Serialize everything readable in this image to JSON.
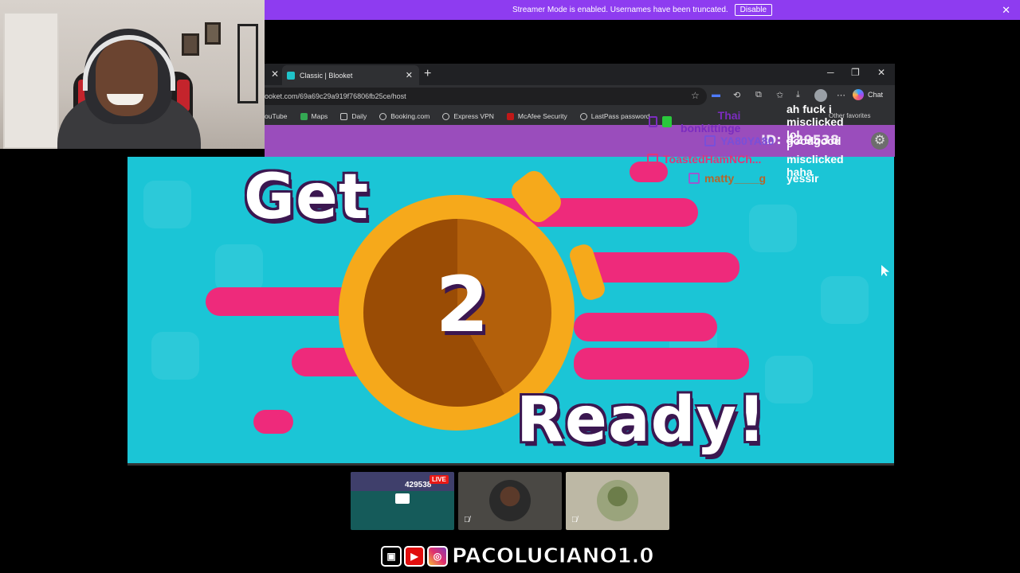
{
  "banner": {
    "text": "Streamer Mode is enabled. Usernames have been truncated.",
    "button": "Disable",
    "close": "✕"
  },
  "browser": {
    "tab_title": "Classic | Blooket",
    "url": "ooket.com/69a69c29a919f76806fb25ce/host",
    "chat_label": "Chat",
    "bookmarks": [
      "ouTube",
      "Maps",
      "Daily",
      "Booking.com",
      "Express VPN",
      "McAfee Security",
      "LastPass password"
    ],
    "other_favorites": "Other favorites",
    "minimize": "─",
    "restore": "❐",
    "close": "✕",
    "new_tab": "+",
    "tab_close": "✕"
  },
  "game": {
    "get": "Get",
    "ready": "Ready!",
    "countdown": "2",
    "game_id": "ID: 429538"
  },
  "chat": [
    {
      "user": "Thai bonkittinge",
      "message": "ah fuck i misclicked lol",
      "color": "#7b2cbf"
    },
    {
      "user": "YA80YA80",
      "message": "goodgood",
      "color": "#7a4fd8"
    },
    {
      "user": "ToastedHamNCh...",
      "message": "i misclicked haha",
      "color": "#e0357a"
    },
    {
      "user": "matty____g",
      "message": "yessir",
      "color": "#b5652b"
    }
  ],
  "tiles": {
    "live": "LIVE",
    "tile1_number": "429538"
  },
  "social": {
    "handle": "PACOLUCIANO1.0"
  },
  "colors": {
    "banner": "#8e3cf0",
    "game_bg": "#1bc5d6",
    "streak": "#ee2a7b",
    "clock": "#f6a91b"
  }
}
